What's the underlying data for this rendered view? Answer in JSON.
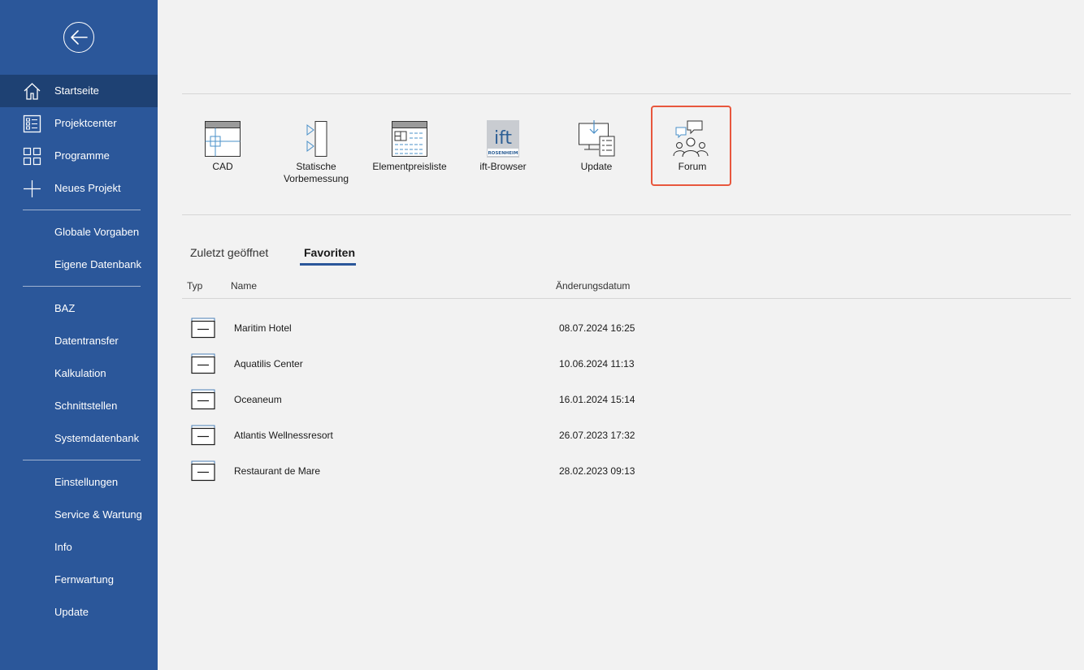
{
  "sidebar": {
    "back_icon": "back-arrow-icon",
    "items": [
      {
        "label": "Startseite",
        "icon": "home-icon",
        "active": true
      },
      {
        "label": "Projektcenter",
        "icon": "project-center-icon"
      },
      {
        "label": "Programme",
        "icon": "grid-icon"
      },
      {
        "label": "Neues Projekt",
        "icon": "plus-icon"
      },
      {
        "label": "Globale Vorgaben"
      },
      {
        "label": "Eigene Datenbank"
      },
      {
        "label": "BAZ"
      },
      {
        "label": "Datentransfer"
      },
      {
        "label": "Kalkulation"
      },
      {
        "label": "Schnittstellen"
      },
      {
        "label": "Systemdatenbank"
      },
      {
        "label": "Einstellungen"
      },
      {
        "label": "Service & Wartung"
      },
      {
        "label": "Info"
      },
      {
        "label": "Fernwartung"
      },
      {
        "label": "Update"
      }
    ]
  },
  "tiles": [
    {
      "label": "CAD",
      "icon": "cad-icon"
    },
    {
      "label": "Statische Vorbemessung",
      "icon": "static-calc-icon"
    },
    {
      "label": "Elementpreisliste",
      "icon": "price-list-icon"
    },
    {
      "label": "ift-Browser",
      "icon": "ift-logo-icon",
      "logo_text": "ift",
      "logo_sub": "ROSENHEIM"
    },
    {
      "label": "Update",
      "icon": "update-icon"
    },
    {
      "label": "Forum",
      "icon": "forum-icon",
      "highlighted": true
    }
  ],
  "tabs": [
    {
      "label": "Zuletzt geöffnet"
    },
    {
      "label": "Favoriten",
      "active": true
    }
  ],
  "table": {
    "headers": [
      "Typ",
      "Name",
      "Änderungsdatum"
    ],
    "rows": [
      {
        "name": "Maritim Hotel",
        "date": "08.07.2024 16:25"
      },
      {
        "name": "Aquatilis Center",
        "date": "10.06.2024 11:13"
      },
      {
        "name": "Oceaneum",
        "date": "16.01.2024 15:14"
      },
      {
        "name": "Atlantis Wellnessresort",
        "date": "26.07.2023 17:32"
      },
      {
        "name": "Restaurant de Mare",
        "date": "28.02.2023 09:13"
      }
    ]
  },
  "colors": {
    "sidebar": "#2b579a",
    "sidebar_active": "#1e4173",
    "highlight_border": "#e8573d",
    "accent": "#2b579a"
  }
}
